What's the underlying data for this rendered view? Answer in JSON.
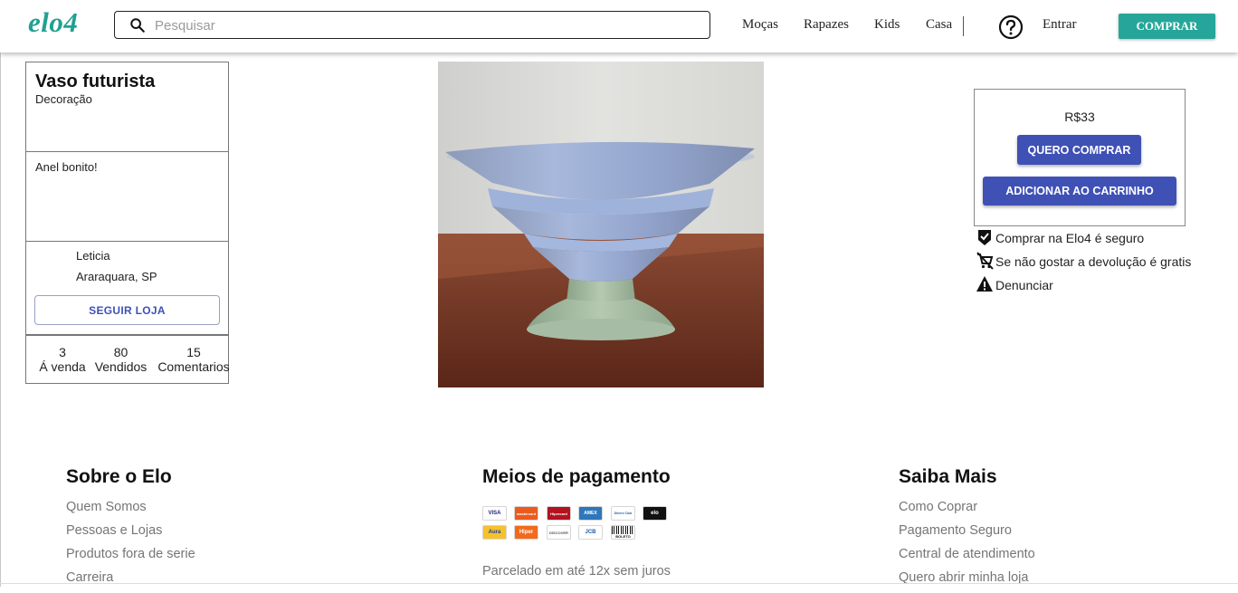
{
  "header": {
    "logo": "elo4",
    "search_placeholder": "Pesquisar",
    "nav": [
      "Moças",
      "Rapazes",
      "Kids",
      "Casa"
    ],
    "login": "Entrar",
    "buy_button": "COMPRAR"
  },
  "product": {
    "title": "Vaso futurista",
    "category": "Decoração",
    "description": "Anel bonito!",
    "price": "R$33",
    "buy_now": "QUERO COMPRAR",
    "add_to_cart": "ADICIONAR AO CARRINHO"
  },
  "seller": {
    "name": "Leticia",
    "location": "Araraquara, SP",
    "follow_button": "SEGUIR LOJA",
    "stats": [
      {
        "value": "3",
        "label": "Á venda"
      },
      {
        "value": "80",
        "label": "Vendidos"
      },
      {
        "value": "15",
        "label": "Comentarios"
      }
    ]
  },
  "info": {
    "secure": "Comprar na Elo4 é seguro",
    "returns": "Se não gostar a devolução é gratis",
    "report": "Denunciar"
  },
  "footer": {
    "about": {
      "title": "Sobre o Elo",
      "links": [
        "Quem Somos",
        "Pessoas e Lojas",
        "Produtos fora de serie",
        "Carreira"
      ]
    },
    "payment": {
      "title": "Meios de pagamento",
      "cards": [
        "VISA",
        "mastercard",
        "Hipercard",
        "AMEX",
        "Diners Club",
        "elo",
        "Aura",
        "Hiper",
        "DISCOVER",
        "JCB",
        "BOLETO"
      ],
      "installments": "Parcelado em até 12x sem juros"
    },
    "more": {
      "title": "Saiba Mais",
      "links": [
        "Como Coprar",
        "Pagamento Seguro",
        "Central de atendimento",
        "Quero abrir minha loja"
      ]
    }
  },
  "colors": {
    "brand": "#21a191",
    "buy_button": "#26a69a",
    "primary": "#3f51b5"
  }
}
